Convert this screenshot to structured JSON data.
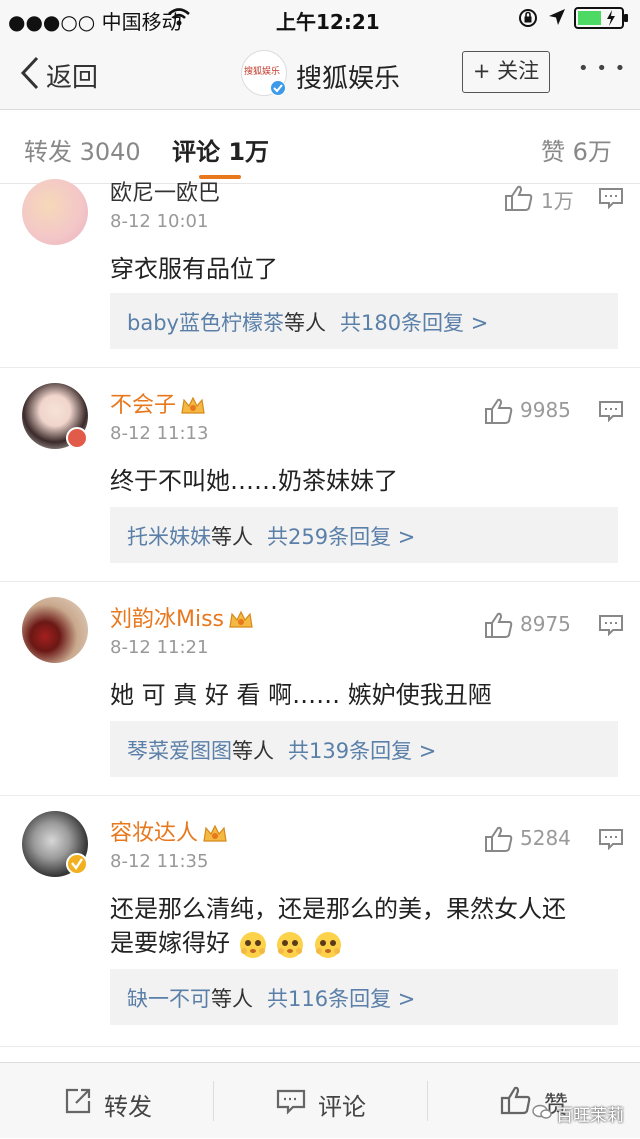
{
  "status_bar": {
    "carrier": "●●●○○ 中国移动",
    "time": "上午12:21"
  },
  "nav": {
    "back_label": "返回",
    "avatar_text": "搜狐娱乐",
    "title": "搜狐娱乐",
    "follow_label": "+ 关注",
    "more_label": "• • •"
  },
  "tabs": {
    "repost": "转发 3040",
    "comment": "评论 1万",
    "likes": "赞 6万"
  },
  "comments": [
    {
      "name": "欧尼一欧巴",
      "time": "8-12 10:01",
      "text": "穿衣服有品位了",
      "likes": "1万",
      "reply_names": "baby蓝色柠檬茶",
      "reply_mid": "等人",
      "reply_count": "共180条回复 >"
    },
    {
      "name": "不会子",
      "time": "8-12 11:13",
      "text": "终于不叫她……奶茶妹妹了",
      "likes": "9985",
      "reply_names": "托米妹妹",
      "reply_mid": "等人",
      "reply_count": "共259条回复 >"
    },
    {
      "name": "刘韵冰Miss",
      "time": "8-12 11:21",
      "text": "她 可 真 好 看 啊…… 嫉妒使我丑陋",
      "likes": "8975",
      "reply_names": "琴菜爱图图",
      "reply_mid": "等人",
      "reply_count": "共139条回复 >"
    },
    {
      "name": "容妆达人",
      "time": "8-12 11:35",
      "text": "还是那么清纯，还是那么的美，果然女人还",
      "text2": "是要嫁得好",
      "likes": "5284",
      "reply_names": "缺一不可",
      "reply_mid": "等人",
      "reply_count": "共116条回复 >"
    }
  ],
  "bottom_bar": {
    "repost": "转发",
    "comment": "评论",
    "like": "赞",
    "watermark": "百旺茉莉"
  },
  "colors": {
    "accent_orange": "#e8781e",
    "link_blue": "#5a7fa8",
    "battery_green": "#4cd964"
  },
  "icons": [
    "back-chevron-icon",
    "wifi-icon",
    "lock-rotation-icon",
    "location-arrow-icon",
    "battery-icon",
    "thumbs-up-icon",
    "comment-icon",
    "crown-icon",
    "verified-icon",
    "share-icon",
    "emoji-icon"
  ]
}
